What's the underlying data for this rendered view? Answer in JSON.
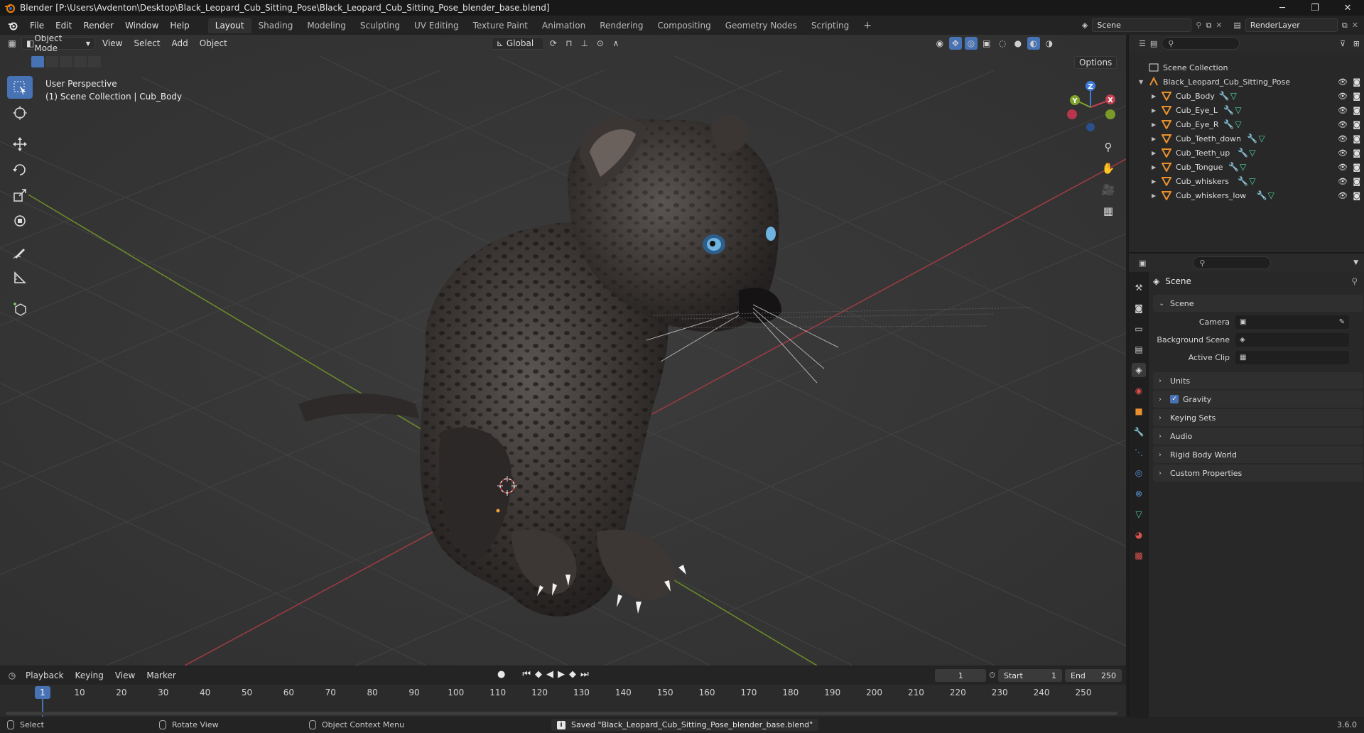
{
  "window": {
    "title": "Blender [P:\\Users\\Avdenton\\Desktop\\Black_Leopard_Cub_Sitting_Pose\\Black_Leopard_Cub_Sitting_Pose_blender_base.blend]",
    "minimize": "─",
    "maximize": "❐",
    "close": "✕"
  },
  "menu": {
    "items": [
      "File",
      "Edit",
      "Render",
      "Window",
      "Help"
    ],
    "workspaces": [
      "Layout",
      "Shading",
      "Modeling",
      "Sculpting",
      "UV Editing",
      "Texture Paint",
      "Animation",
      "Rendering",
      "Compositing",
      "Geometry Nodes",
      "Scripting"
    ],
    "active_workspace": "Layout",
    "add_workspace": "+",
    "scene_name": "Scene",
    "view_layer": "RenderLayer"
  },
  "viewport": {
    "mode": "Object Mode",
    "menus": [
      "View",
      "Select",
      "Add",
      "Object"
    ],
    "orientation": "Global",
    "options_label": "Options",
    "perspective": "User Perspective",
    "collection_info": "(1) Scene Collection | Cub_Body",
    "gizmo_axes": {
      "z": "Z",
      "y": "Y",
      "x": "X"
    },
    "colors": {
      "x_axis": "#c2404f",
      "y_axis": "#7ea32d",
      "z_axis": "#3d7ddb",
      "grid": "#444444",
      "bg": "#393939"
    }
  },
  "timeline": {
    "menus": [
      "Playback",
      "Keying",
      "View",
      "Marker"
    ],
    "current_frame": "1",
    "start_label": "Start",
    "start_value": "1",
    "end_label": "End",
    "end_value": "250",
    "ruler": [
      "10",
      "20",
      "30",
      "40",
      "50",
      "60",
      "70",
      "80",
      "90",
      "100",
      "110",
      "120",
      "130",
      "140",
      "150",
      "160",
      "170",
      "180",
      "190",
      "200",
      "210",
      "220",
      "230",
      "240",
      "250"
    ],
    "playhead_label": "1"
  },
  "status": {
    "select": "Select",
    "rotate": "Rotate View",
    "context": "Object Context Menu",
    "message": "Saved \"Black_Leopard_Cub_Sitting_Pose_blender_base.blend\"",
    "version": "3.6.0"
  },
  "outliner": {
    "root": "Scene Collection",
    "collection": "Black_Leopard_Cub_Sitting_Pose",
    "objects": [
      "Cub_Body",
      "Cub_Eye_L",
      "Cub_Eye_R",
      "Cub_Teeth_down",
      "Cub_Teeth_up",
      "Cub_Tongue",
      "Cub_whiskers",
      "Cub_whiskers_low"
    ]
  },
  "properties": {
    "context_title": "Scene",
    "panel_title": "Scene",
    "camera_label": "Camera",
    "background_scene_label": "Background Scene",
    "active_clip_label": "Active Clip",
    "subpanels": [
      "Units",
      "Gravity",
      "Keying Sets",
      "Audio",
      "Rigid Body World",
      "Custom Properties"
    ],
    "gravity_checked": true
  }
}
